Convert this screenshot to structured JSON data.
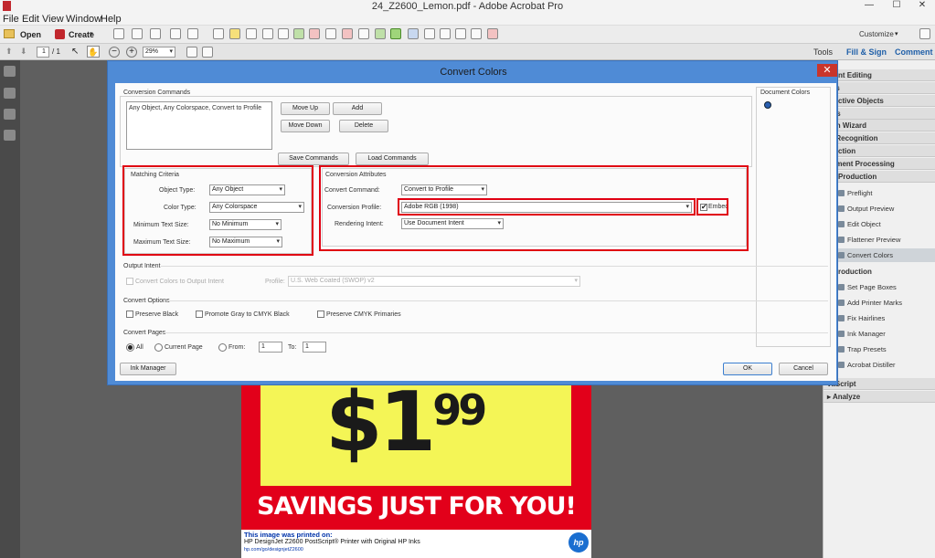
{
  "window": {
    "title": "24_Z2600_Lemon.pdf - Adobe Acrobat Pro",
    "minimize": "—",
    "maximize": "☐",
    "close": "✕"
  },
  "menu": [
    "File",
    "Edit",
    "View",
    "Window",
    "Help"
  ],
  "toolbar": {
    "open": "Open",
    "create": "Create",
    "customize": "Customize"
  },
  "nav": {
    "page_current": "1",
    "page_total": "/ 1",
    "zoom": "29%",
    "tools": "Tools",
    "fill_sign": "Fill & Sign",
    "comment": "Comment"
  },
  "dialog": {
    "title": "Convert Colors",
    "conversion_commands_label": "Conversion Commands",
    "command_item": "Any Object, Any Colorspace, Convert to Profile",
    "move_up": "Move Up",
    "add": "Add",
    "move_down": "Move Down",
    "delete": "Delete",
    "save_commands": "Save Commands",
    "load_commands": "Load Commands",
    "document_colors_label": "Document Colors",
    "matching": {
      "label": "Matching Criteria",
      "object_type_label": "Object Type:",
      "object_type_value": "Any Object",
      "color_type_label": "Color Type:",
      "color_type_value": "Any Colorspace",
      "min_text_label": "Minimum Text Size:",
      "min_text_value": "No Minimum",
      "max_text_label": "Maximum Text Size:",
      "max_text_value": "No Maximum"
    },
    "attributes": {
      "label": "Conversion Attributes",
      "command_label": "Convert Command:",
      "command_value": "Convert to Profile",
      "profile_label": "Conversion Profile:",
      "profile_value": "Adobe RGB (1998)",
      "embed_label": "Embed",
      "intent_label": "Rendering Intent:",
      "intent_value": "Use Document Intent"
    },
    "output_intent": {
      "label": "Output Intent",
      "checkbox_label": "Convert Colors to Output Intent",
      "profile_label": "Profile:",
      "profile_value": "U.S. Web Coated (SWOP) v2"
    },
    "options": {
      "label": "Convert Options",
      "preserve_black": "Preserve Black",
      "promote_gray": "Promote Gray to CMYK Black",
      "preserve_cmyk": "Preserve CMYK Primaries"
    },
    "pages": {
      "label": "Convert Pages",
      "all": "All",
      "current": "Current Page",
      "from": "From:",
      "from_value": "1",
      "to": "To:",
      "to_value": "1"
    },
    "ink_manager": "Ink Manager",
    "ok": "OK",
    "cancel": "Cancel"
  },
  "right_pane": {
    "headers": [
      "ntent Editing",
      "ges",
      "eractive Objects",
      "rms",
      "tion Wizard",
      "xt Recognition",
      "otection",
      "cument Processing",
      "int Production"
    ],
    "print_items": [
      "Preflight",
      "Output Preview",
      "Edit Object",
      "Flattener Preview",
      "Convert Colors"
    ],
    "prepress_header": "e Production",
    "prepress_items": [
      "Set Page Boxes",
      "Add Printer Marks",
      "Fix Hairlines",
      "Ink Manager",
      "Trap Presets",
      "Acrobat Distiller"
    ],
    "bottom_headers": [
      "vaScript",
      "▸ Analyze"
    ]
  },
  "document": {
    "price": "$1",
    "cents": "99",
    "savings": "SAVINGS JUST FOR YOU!",
    "printed_on": "This image was printed on:",
    "printer": "HP DesignJet Z2600 PostScript® Printer with Original HP Inks",
    "url": "hp.com/go/designjetZ2600",
    "hp_logo": "hp"
  }
}
